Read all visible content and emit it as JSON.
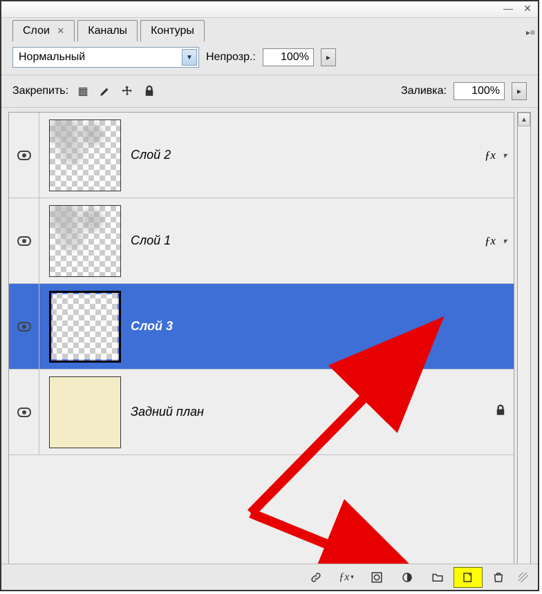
{
  "window": {
    "minimize": "—",
    "close": "✕"
  },
  "tabs": [
    {
      "label": "Слои",
      "active": true,
      "closable": true
    },
    {
      "label": "Каналы",
      "active": false,
      "closable": false
    },
    {
      "label": "Контуры",
      "active": false,
      "closable": false
    }
  ],
  "blend_mode": {
    "value": "Нормальный"
  },
  "opacity": {
    "label": "Непрозр.:",
    "value": "100%"
  },
  "lock": {
    "label": "Закрепить:"
  },
  "lock_icons": {
    "pixels": "▦",
    "brush": "✎",
    "move": "✥",
    "all": "🔒"
  },
  "fill": {
    "label": "Заливка:",
    "value": "100%"
  },
  "layers": [
    {
      "name": "Слой 2",
      "visible": true,
      "selected": false,
      "thumb": "smudge",
      "fx": true,
      "locked": false
    },
    {
      "name": "Слой 1",
      "visible": true,
      "selected": false,
      "thumb": "smudge",
      "fx": true,
      "locked": false
    },
    {
      "name": "Слой 3",
      "visible": true,
      "selected": true,
      "thumb": "checker",
      "fx": false,
      "locked": false
    },
    {
      "name": "Задний план",
      "visible": true,
      "selected": false,
      "thumb": "solid",
      "fx": false,
      "locked": true
    }
  ],
  "fx_label": "ƒx",
  "bottom_tools": {
    "link": "⟲",
    "fx": "ƒx",
    "mask": "◯",
    "adjust": "◐",
    "group": "▭",
    "new": "▣",
    "trash": "🗑"
  },
  "triangle": "▸",
  "triangle_down": "▾",
  "scroll": {
    "up": "▲",
    "down": "▼"
  },
  "menu_icon": "▸≡"
}
